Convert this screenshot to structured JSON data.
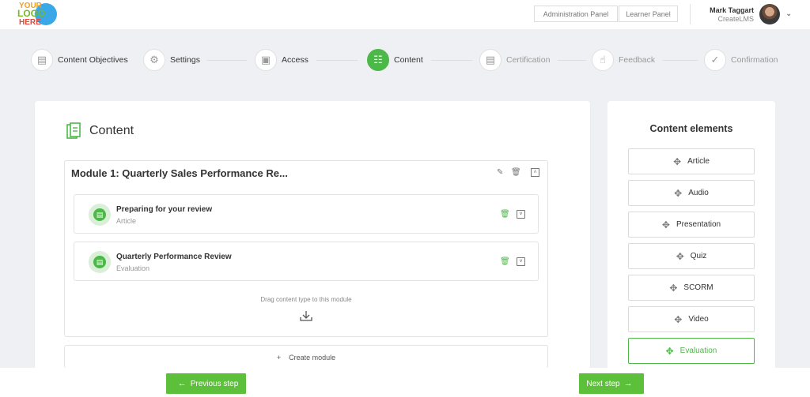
{
  "logo": {
    "line1": "YOUR",
    "line2": "LOGO",
    "line3": "HERE"
  },
  "header": {
    "admin_panel": "Administration Panel",
    "learner_panel": "Learner Panel",
    "user_name": "Mark Taggart",
    "user_org": "CreateLMS"
  },
  "steps": [
    {
      "label": "Content Objectives",
      "state": "done"
    },
    {
      "label": "Settings",
      "state": "done"
    },
    {
      "label": "Access",
      "state": "done"
    },
    {
      "label": "Content",
      "state": "active"
    },
    {
      "label": "Certification",
      "state": "future"
    },
    {
      "label": "Feedback",
      "state": "future"
    },
    {
      "label": "Confirmation",
      "state": "future"
    }
  ],
  "main": {
    "title": "Content",
    "module": {
      "title": "Module 1: Quarterly Sales Performance Re...",
      "items": [
        {
          "title": "Preparing for your review",
          "type": "Article"
        },
        {
          "title": "Quarterly Performance Review",
          "type": "Evaluation"
        }
      ],
      "drag_hint": "Drag content type to this module"
    },
    "create_module": "Create module"
  },
  "side": {
    "title": "Content elements",
    "elements": [
      "Article",
      "Audio",
      "Presentation",
      "Quiz",
      "SCORM",
      "Video",
      "Evaluation"
    ]
  },
  "footer": {
    "previous": "Previous step",
    "next": "Next step"
  },
  "colors": {
    "accent": "#4cb848",
    "button": "#5cc03a",
    "background": "#eef0f3"
  }
}
